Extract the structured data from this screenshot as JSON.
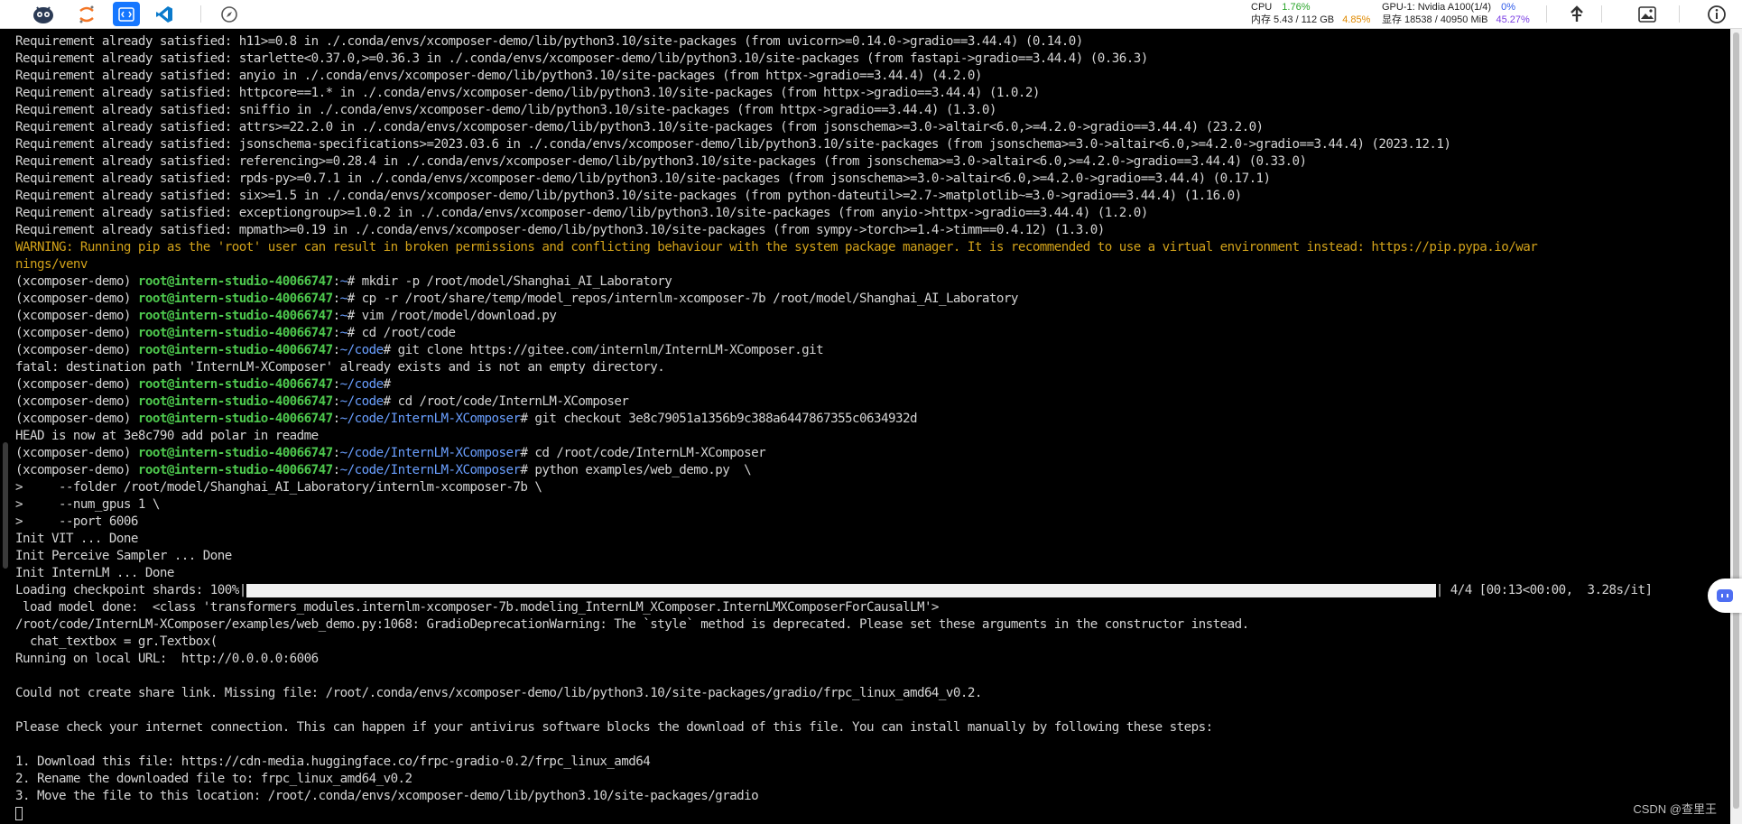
{
  "toolbar": {
    "icons": [
      "mascot-logo-icon",
      "jupyter-icon",
      "code-editor-icon",
      "vscode-icon",
      "compass-icon"
    ],
    "cpu_label": "CPU",
    "cpu_value": "1.76%",
    "gpu_label": "GPU-1: Nvidia A100(1/4)",
    "gpu_value": "0%",
    "mem_label": "内存 5.43 / 112 GB",
    "mem_value": "4.85%",
    "vram_label": "显存 18538 / 40950 MiB",
    "vram_value": "45.27%",
    "right_icons": [
      "upload-icon",
      "image-icon",
      "info-icon"
    ]
  },
  "colors": {
    "terminal_bg": "#000000",
    "terminal_fg": "#d4d4d4",
    "warning": "#d2a21a",
    "prompt_user": "#4ec94e",
    "prompt_path": "#6a9fff",
    "active_tab": "#1677ff"
  },
  "terminal": {
    "lines": [
      {
        "t": "plain",
        "text": "Requirement already satisfied: h11>=0.8 in ./.conda/envs/xcomposer-demo/lib/python3.10/site-packages (from uvicorn>=0.14.0->gradio==3.44.4) (0.14.0)"
      },
      {
        "t": "plain",
        "text": "Requirement already satisfied: starlette<0.37.0,>=0.36.3 in ./.conda/envs/xcomposer-demo/lib/python3.10/site-packages (from fastapi->gradio==3.44.4) (0.36.3)"
      },
      {
        "t": "plain",
        "text": "Requirement already satisfied: anyio in ./.conda/envs/xcomposer-demo/lib/python3.10/site-packages (from httpx->gradio==3.44.4) (4.2.0)"
      },
      {
        "t": "plain",
        "text": "Requirement already satisfied: httpcore==1.* in ./.conda/envs/xcomposer-demo/lib/python3.10/site-packages (from httpx->gradio==3.44.4) (1.0.2)"
      },
      {
        "t": "plain",
        "text": "Requirement already satisfied: sniffio in ./.conda/envs/xcomposer-demo/lib/python3.10/site-packages (from httpx->gradio==3.44.4) (1.3.0)"
      },
      {
        "t": "plain",
        "text": "Requirement already satisfied: attrs>=22.2.0 in ./.conda/envs/xcomposer-demo/lib/python3.10/site-packages (from jsonschema>=3.0->altair<6.0,>=4.2.0->gradio==3.44.4) (23.2.0)"
      },
      {
        "t": "plain",
        "text": "Requirement already satisfied: jsonschema-specifications>=2023.03.6 in ./.conda/envs/xcomposer-demo/lib/python3.10/site-packages (from jsonschema>=3.0->altair<6.0,>=4.2.0->gradio==3.44.4) (2023.12.1)"
      },
      {
        "t": "plain",
        "text": "Requirement already satisfied: referencing>=0.28.4 in ./.conda/envs/xcomposer-demo/lib/python3.10/site-packages (from jsonschema>=3.0->altair<6.0,>=4.2.0->gradio==3.44.4) (0.33.0)"
      },
      {
        "t": "plain",
        "text": "Requirement already satisfied: rpds-py>=0.7.1 in ./.conda/envs/xcomposer-demo/lib/python3.10/site-packages (from jsonschema>=3.0->altair<6.0,>=4.2.0->gradio==3.44.4) (0.17.1)"
      },
      {
        "t": "plain",
        "text": "Requirement already satisfied: six>=1.5 in ./.conda/envs/xcomposer-demo/lib/python3.10/site-packages (from python-dateutil>=2.7->matplotlib~=3.0->gradio==3.44.4) (1.16.0)"
      },
      {
        "t": "plain",
        "text": "Requirement already satisfied: exceptiongroup>=1.0.2 in ./.conda/envs/xcomposer-demo/lib/python3.10/site-packages (from anyio->httpx->gradio==3.44.4) (1.2.0)"
      },
      {
        "t": "plain",
        "text": "Requirement already satisfied: mpmath>=0.19 in ./.conda/envs/xcomposer-demo/lib/python3.10/site-packages (from sympy->torch>=1.4->timm==0.4.12) (1.3.0)"
      },
      {
        "t": "warn",
        "text": "WARNING: Running pip as the 'root' user can result in broken permissions and conflicting behaviour with the system package manager. It is recommended to use a virtual environment instead: https://pip.pypa.io/war"
      },
      {
        "t": "warn",
        "text": "nings/venv"
      },
      {
        "t": "prompt",
        "env": "(xcomposer-demo) ",
        "user": "root@intern-studio-40066747",
        "sep": ":",
        "path": "~",
        "cmd": "# mkdir -p /root/model/Shanghai_AI_Laboratory"
      },
      {
        "t": "prompt",
        "env": "(xcomposer-demo) ",
        "user": "root@intern-studio-40066747",
        "sep": ":",
        "path": "~",
        "cmd": "# cp -r /root/share/temp/model_repos/internlm-xcomposer-7b /root/model/Shanghai_AI_Laboratory"
      },
      {
        "t": "prompt",
        "env": "(xcomposer-demo) ",
        "user": "root@intern-studio-40066747",
        "sep": ":",
        "path": "~",
        "cmd": "# vim /root/model/download.py"
      },
      {
        "t": "prompt",
        "env": "(xcomposer-demo) ",
        "user": "root@intern-studio-40066747",
        "sep": ":",
        "path": "~",
        "cmd": "# cd /root/code"
      },
      {
        "t": "prompt",
        "env": "(xcomposer-demo) ",
        "user": "root@intern-studio-40066747",
        "sep": ":",
        "path": "~/code",
        "cmd": "# git clone https://gitee.com/internlm/InternLM-XComposer.git"
      },
      {
        "t": "plain",
        "text": "fatal: destination path 'InternLM-XComposer' already exists and is not an empty directory."
      },
      {
        "t": "prompt",
        "env": "(xcomposer-demo) ",
        "user": "root@intern-studio-40066747",
        "sep": ":",
        "path": "~/code",
        "cmd": "#"
      },
      {
        "t": "prompt",
        "env": "(xcomposer-demo) ",
        "user": "root@intern-studio-40066747",
        "sep": ":",
        "path": "~/code",
        "cmd": "# cd /root/code/InternLM-XComposer"
      },
      {
        "t": "prompt",
        "env": "(xcomposer-demo) ",
        "user": "root@intern-studio-40066747",
        "sep": ":",
        "path": "~/code/InternLM-XComposer",
        "cmd": "# git checkout 3e8c79051a1356b9c388a6447867355c0634932d"
      },
      {
        "t": "plain",
        "text": "HEAD is now at 3e8c790 add polar in readme"
      },
      {
        "t": "prompt",
        "env": "(xcomposer-demo) ",
        "user": "root@intern-studio-40066747",
        "sep": ":",
        "path": "~/code/InternLM-XComposer",
        "cmd": "# cd /root/code/InternLM-XComposer"
      },
      {
        "t": "prompt",
        "env": "(xcomposer-demo) ",
        "user": "root@intern-studio-40066747",
        "sep": ":",
        "path": "~/code/InternLM-XComposer",
        "cmd": "# python examples/web_demo.py  \\"
      },
      {
        "t": "plain",
        "text": ">     --folder /root/model/Shanghai_AI_Laboratory/internlm-xcomposer-7b \\"
      },
      {
        "t": "plain",
        "text": ">     --num_gpus 1 \\"
      },
      {
        "t": "plain",
        "text": ">     --port 6006"
      },
      {
        "t": "plain",
        "text": "Init VIT ... Done"
      },
      {
        "t": "plain",
        "text": "Init Perceive Sampler ... Done"
      },
      {
        "t": "plain",
        "text": "Init InternLM ... Done"
      },
      {
        "t": "progress",
        "pre": "Loading checkpoint shards: 100%|",
        "post": "| 4/4 [00:13<00:00,  3.28s/it]",
        "fraction": 1.0
      },
      {
        "t": "plain",
        "text": " load model done:  <class 'transformers_modules.internlm-xcomposer-7b.modeling_InternLM_XComposer.InternLMXComposerForCausalLM'>"
      },
      {
        "t": "plain",
        "text": "/root/code/InternLM-XComposer/examples/web_demo.py:1068: GradioDeprecationWarning: The `style` method is deprecated. Please set these arguments in the constructor instead."
      },
      {
        "t": "plain",
        "text": "  chat_textbox = gr.Textbox("
      },
      {
        "t": "plain",
        "text": "Running on local URL:  http://0.0.0.0:6006"
      },
      {
        "t": "plain",
        "text": ""
      },
      {
        "t": "plain",
        "text": "Could not create share link. Missing file: /root/.conda/envs/xcomposer-demo/lib/python3.10/site-packages/gradio/frpc_linux_amd64_v0.2."
      },
      {
        "t": "plain",
        "text": ""
      },
      {
        "t": "plain",
        "text": "Please check your internet connection. This can happen if your antivirus software blocks the download of this file. You can install manually by following these steps:"
      },
      {
        "t": "plain",
        "text": ""
      },
      {
        "t": "plain",
        "text": "1. Download this file: https://cdn-media.huggingface.co/frpc-gradio-0.2/frpc_linux_amd64"
      },
      {
        "t": "plain",
        "text": "2. Rename the downloaded file to: frpc_linux_amd64_v0.2"
      },
      {
        "t": "plain",
        "text": "3. Move the file to this location: /root/.conda/envs/xcomposer-demo/lib/python3.10/site-packages/gradio"
      },
      {
        "t": "cursor"
      }
    ]
  },
  "watermark": "CSDN @查里王"
}
